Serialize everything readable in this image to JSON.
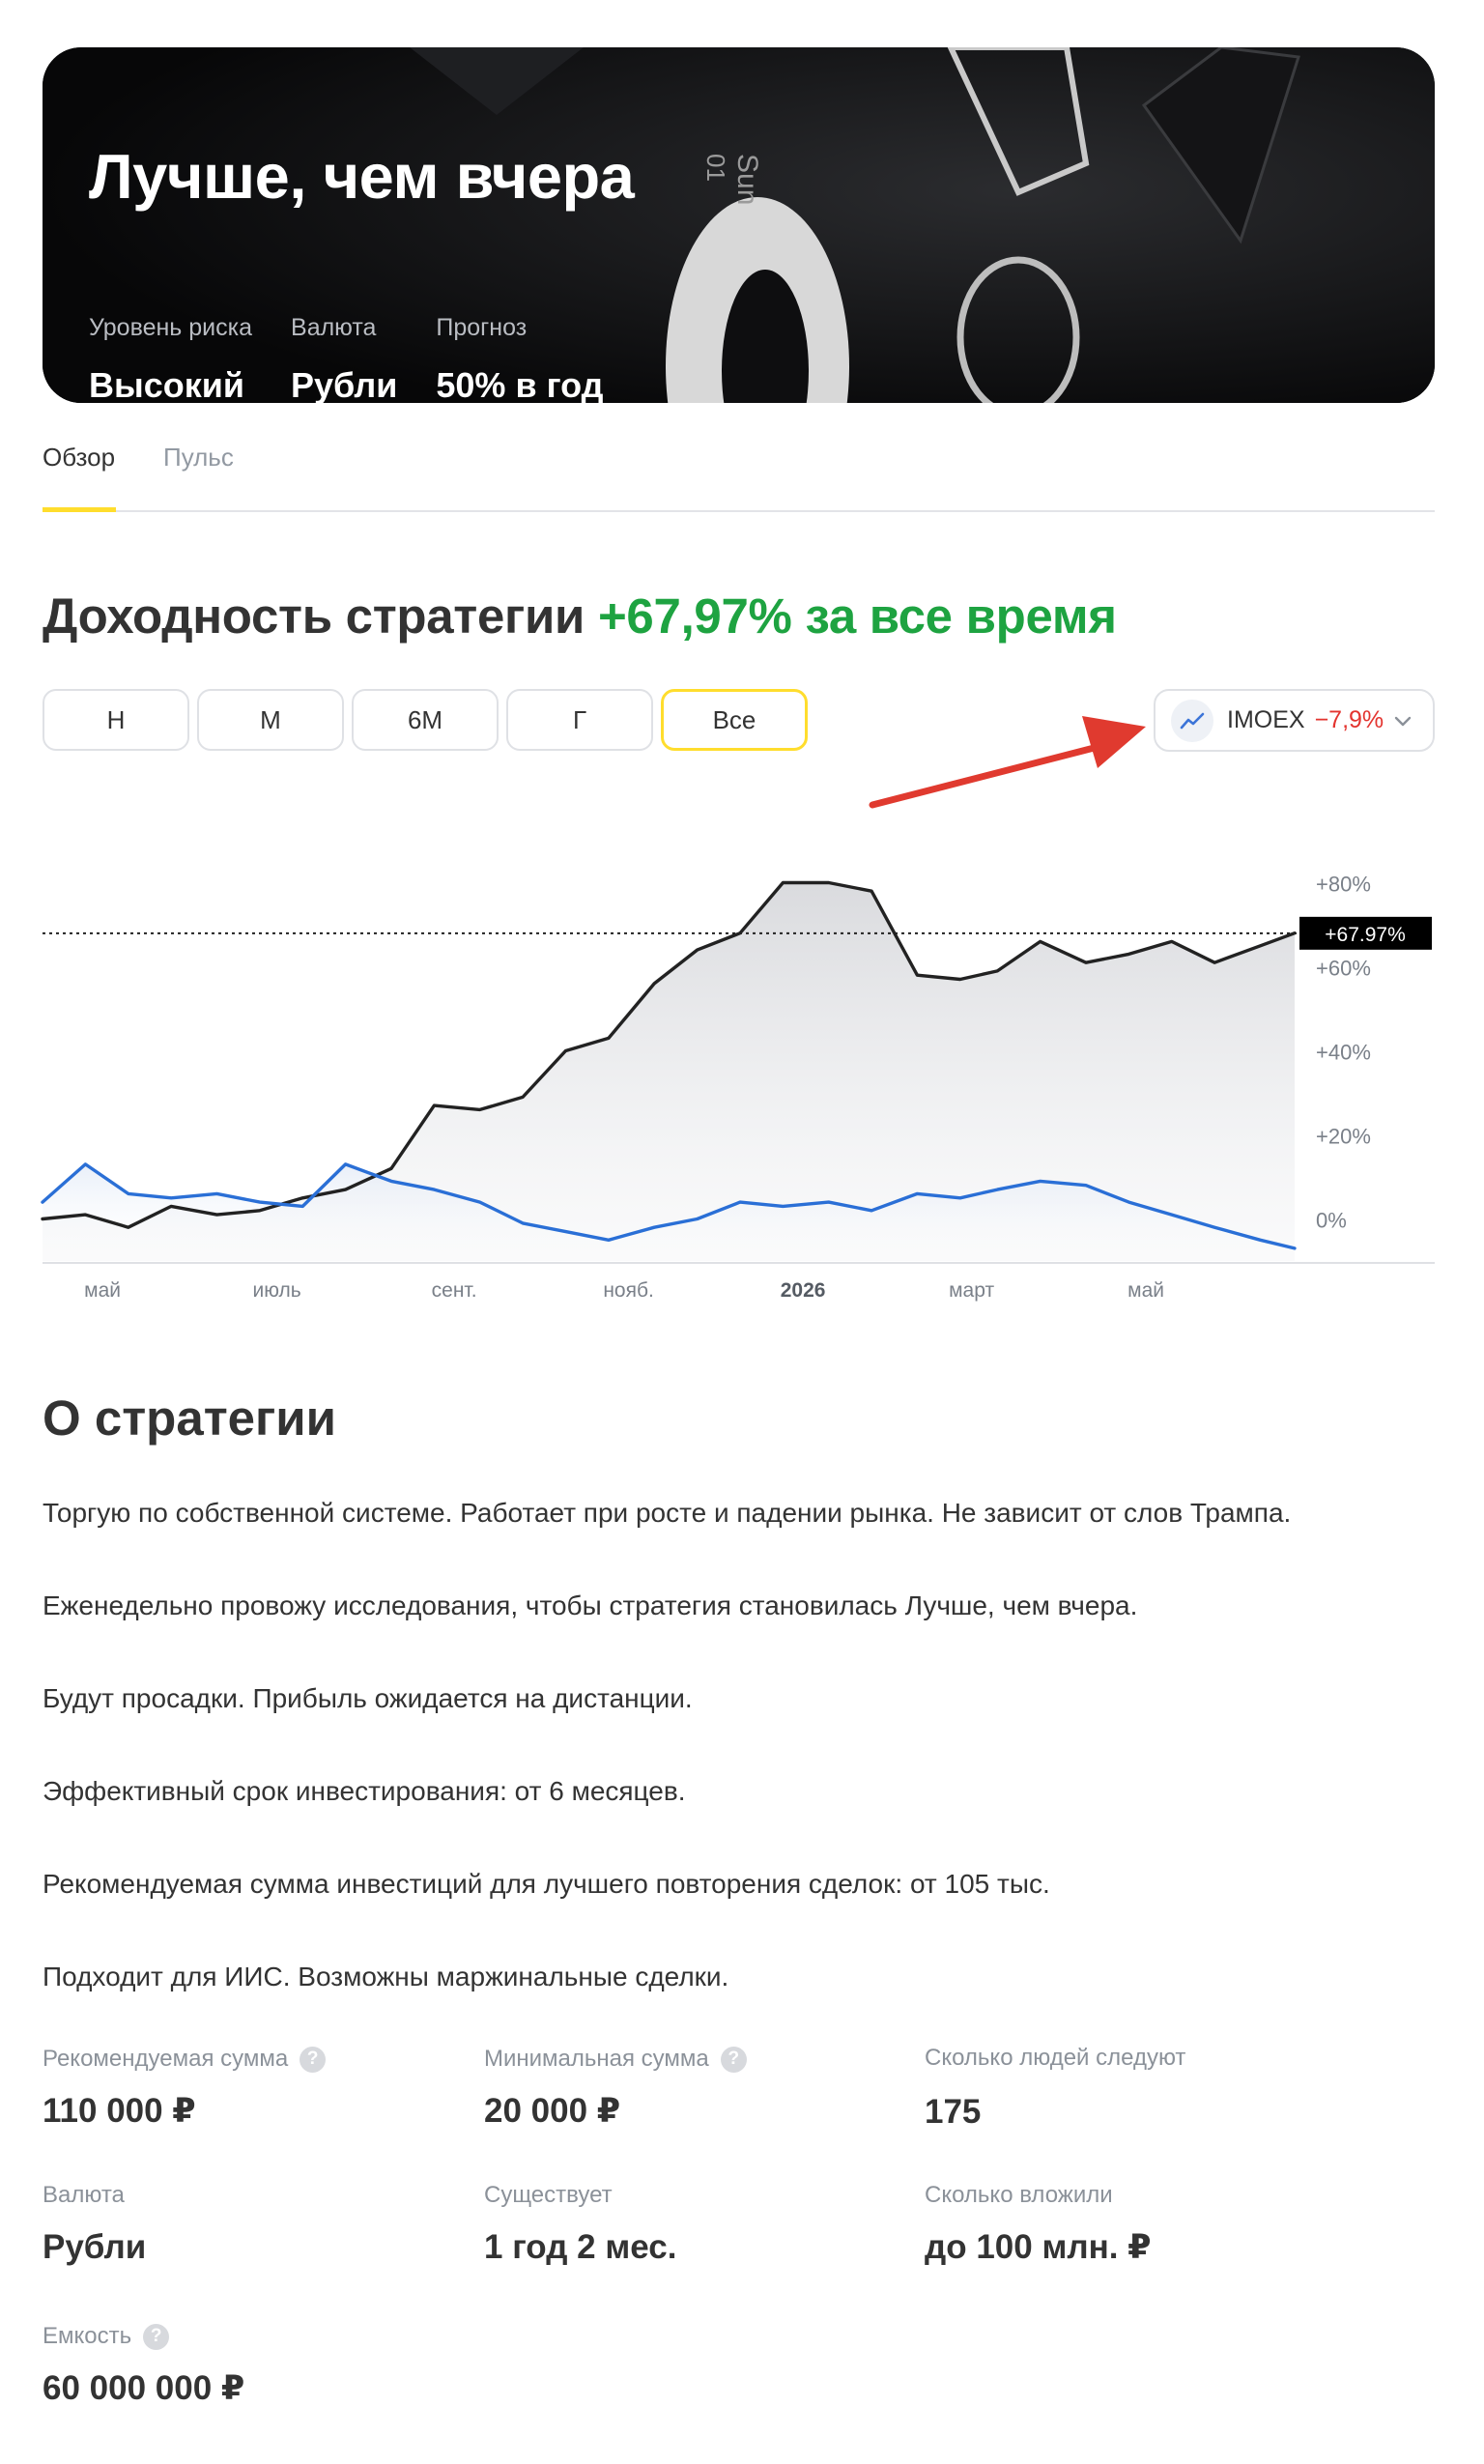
{
  "hero": {
    "title": "Лучше, чем вчера",
    "facts": [
      {
        "label": "Уровень риска",
        "value": "Высокий"
      },
      {
        "label": "Валюта",
        "value": "Рубли"
      },
      {
        "label": "Прогноз",
        "value": "50% в год"
      }
    ],
    "background_glyphs": {
      "day": "Sun",
      "date": "01"
    }
  },
  "tabs": [
    {
      "label": "Обзор",
      "active": true
    },
    {
      "label": "Пульс",
      "active": false
    }
  ],
  "returns": {
    "title_prefix": "Доходность стратегии",
    "title_highlight": "+67,97% за все время",
    "highlight_color": "#1ea341"
  },
  "periods": [
    {
      "label": "Н",
      "active": false
    },
    {
      "label": "М",
      "active": false
    },
    {
      "label": "6М",
      "active": false
    },
    {
      "label": "Г",
      "active": false
    },
    {
      "label": "Все",
      "active": true
    }
  ],
  "benchmark": {
    "icon": "trend-line-icon",
    "name": "IMOEX",
    "change": "−7,9%",
    "change_color": "#e3342f"
  },
  "annotation": {
    "icon": "red-arrow-icon",
    "color": "#e03a2f"
  },
  "chart_data": {
    "type": "line",
    "x": [
      "2025-04-10",
      "2025-04-25",
      "2025-05-10",
      "2025-05-25",
      "2025-06-10",
      "2025-06-25",
      "2025-07-10",
      "2025-07-25",
      "2025-08-10",
      "2025-08-25",
      "2025-09-10",
      "2025-09-25",
      "2025-10-10",
      "2025-10-25",
      "2025-11-10",
      "2025-11-25",
      "2025-12-10",
      "2025-12-25",
      "2026-01-10",
      "2026-01-25",
      "2026-02-10",
      "2026-02-25",
      "2026-03-10",
      "2026-03-25",
      "2026-04-10",
      "2026-04-25",
      "2026-05-10",
      "2026-05-25",
      "2026-06-10",
      "2026-06-22"
    ],
    "series": [
      {
        "color": "#222222",
        "values": [
          0,
          1,
          -2,
          3,
          1,
          2,
          5,
          7,
          12,
          27,
          26,
          29,
          40,
          43,
          56,
          64,
          68,
          80,
          80,
          78,
          58,
          57,
          59,
          66,
          61,
          63,
          66,
          61,
          65,
          68
        ]
      },
      {
        "color": "#2a6fd6",
        "values": [
          4,
          13,
          6,
          5,
          6,
          4,
          3,
          13,
          9,
          7,
          4,
          -1,
          -3,
          -5,
          -2,
          0,
          4,
          3,
          4,
          2,
          6,
          5,
          7,
          9,
          8,
          4,
          1,
          -2,
          -5,
          -7
        ]
      }
    ],
    "x_tick_labels": [
      "май",
      "июль",
      "сент.",
      "нояб.",
      "2026",
      "март",
      "май"
    ],
    "x_tick_bold": "2026",
    "y_tick_labels": [
      "+80%",
      "+60%",
      "+40%",
      "+20%",
      "0%"
    ],
    "y_ticks": [
      80,
      60,
      40,
      20,
      0
    ],
    "ylim": [
      -10,
      90
    ],
    "current_label": "+67.97%",
    "current_value": 67.97
  },
  "about": {
    "title": "О стратегии",
    "paragraphs": [
      "Торгую по собственной системе. Работает при росте и падении рынка. Не зависит от слов Трампа.",
      "Еженедельно провожу исследования, чтобы стратегия становилась Лучше, чем вчера.",
      "Будут просадки. Прибыль ожидается на дистанции.",
      "Эффективный срок инвестирования: от 6 месяцев.",
      "Рекомендуемая сумма инвестиций для лучшего повторения сделок: от 105 тыс.",
      "Подходит для ИИС. Возможны маржинальные сделки."
    ],
    "stats": [
      {
        "label": "Рекомендуемая сумма",
        "value": "110 000 ₽",
        "help": true
      },
      {
        "label": "Минимальная сумма",
        "value": "20 000 ₽",
        "help": true
      },
      {
        "label": "Сколько людей следуют",
        "value": "175",
        "help": false
      },
      {
        "label": "Валюта",
        "value": "Рубли",
        "help": false
      },
      {
        "label": "Существует",
        "value": "1 год 2 мес.",
        "help": false
      },
      {
        "label": "Сколько вложили",
        "value": "до 100 млн. ₽",
        "help": false
      },
      {
        "label": "Емкость",
        "value": "60 000 000 ₽",
        "help": true
      }
    ],
    "help_glyph": "?"
  }
}
